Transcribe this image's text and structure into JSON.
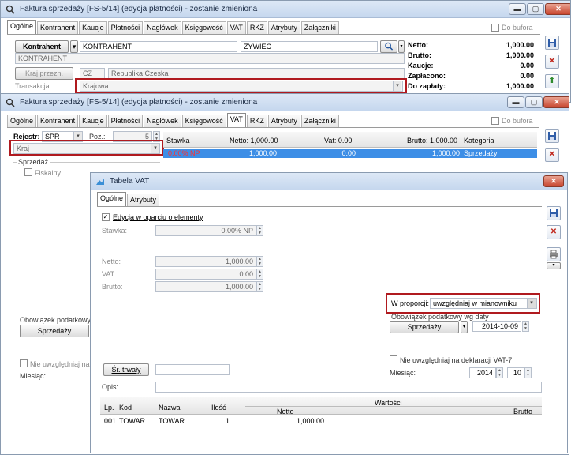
{
  "w1": {
    "title": "Faktura sprzedaży [FS-5/14] (edycja płatności) - zostanie zmieniona",
    "tabs": [
      "Ogólne",
      "Kontrahent",
      "Kaucje",
      "Płatności",
      "Nagłówek",
      "Księgowość",
      "VAT",
      "RKZ",
      "Atrybuty",
      "Załączniki"
    ],
    "do_bufora": "Do bufora",
    "kontrahent_btn": "Kontrahent",
    "kontrahent_code": "KONTRAHENT",
    "kontrahent_city": "ŻYWIEC",
    "kontrahent_name": "KONTRAHENT",
    "kraj_btn": "Kraj przezn.",
    "kraj_code": "CZ",
    "kraj_name": "Republika Czeska",
    "transakcja_label": "Transakcja:",
    "transakcja_value": "Krajowa",
    "totals": [
      {
        "label": "Netto:",
        "value": "1,000.00"
      },
      {
        "label": "Brutto:",
        "value": "1,000.00"
      },
      {
        "label": "Kaucje:",
        "value": "0.00"
      },
      {
        "label": "Zapłacono:",
        "value": "0.00"
      },
      {
        "label": "Do zapłaty:",
        "value": "1,000.00"
      }
    ]
  },
  "w2": {
    "title": "Faktura sprzedaży [FS-5/14] (edycja płatności) - zostanie zmieniona",
    "tabs": [
      "Ogólne",
      "Kontrahent",
      "Kaucje",
      "Płatności",
      "Nagłówek",
      "Księgowość",
      "VAT",
      "RKZ",
      "Atrybuty",
      "Załączniki"
    ],
    "do_bufora": "Do bufora",
    "rejestr_label": "Rejestr:",
    "rejestr_value": "SPR",
    "poz_label": "Poz.:",
    "poz_value": "5",
    "kraj_value": "Kraj",
    "sprzedaz_label": "Sprzedaż",
    "fiskalny_label": "Fiskalny",
    "grid_head": {
      "stawka": "Stawka",
      "netto": "Netto: 1,000.00",
      "vat": "Vat: 0.00",
      "brutto": "Brutto: 1,000.00",
      "kategoria": "Kategoria"
    },
    "grid_row": {
      "stawka": "0.00% NP",
      "netto": "1,000.00",
      "vat": "0.00",
      "brutto": "1,000.00",
      "kategoria": "Sprzedaży"
    },
    "obowiazek_label": "Obowiązek podatkowy",
    "sprzedazy_btn": "Sprzedaży",
    "nie_uwzgl_label": "Nie uwzględniaj na g",
    "miesiac_label": "Miesiąc:"
  },
  "w3": {
    "title": "Tabela VAT",
    "tabs": [
      "Ogólne",
      "Atrybuty"
    ],
    "edycja_label": "Edycja w oparciu o elementy",
    "stawka_label": "Stawka:",
    "stawka_value": "0.00% NP",
    "netto_label": "Netto:",
    "netto_value": "1,000.00",
    "vat_label": "VAT:",
    "vat_value": "0.00",
    "brutto_label": "Brutto:",
    "brutto_value": "1,000.00",
    "proporcji_label": "W proporcji:",
    "proporcji_value": "uwzględniaj w mianowniku",
    "obowiazek_label": "Obowiązek podatkowy wg daty",
    "sprzedazy_btn": "Sprzedaży",
    "data_value": "2014-10-09",
    "nie_uwzgl_label": "Nie uwzględniaj na deklaracji VAT-7",
    "miesiac_label": "Miesiąc:",
    "rok_value": "2014",
    "mies_value": "10",
    "sr_trwaly_btn": "Śr. trwały",
    "opis_label": "Opis:",
    "table_head": {
      "lp": "Lp.",
      "kod": "Kod",
      "nazwa": "Nazwa",
      "ilosc": "Ilość",
      "wartosci": "Wartości",
      "netto": "Netto",
      "brutto": "Brutto"
    },
    "table_rows": [
      {
        "lp": "001",
        "kod": "TOWAR",
        "nazwa": "TOWAR",
        "ilosc": "1",
        "netto": "1,000.00"
      }
    ]
  }
}
